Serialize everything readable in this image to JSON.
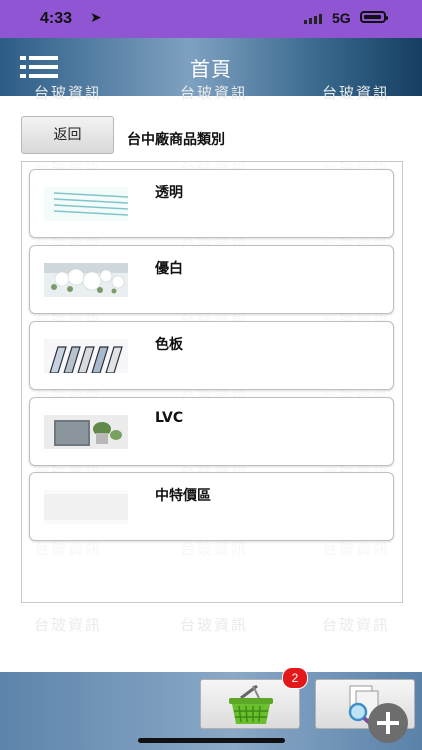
{
  "status_bar": {
    "time": "4:33",
    "network": "5G"
  },
  "header": {
    "title": "首頁"
  },
  "toolbar": {
    "back_label": "返回",
    "breadcrumb": "台中廠商品類別"
  },
  "categories": [
    {
      "label": "透明",
      "icon": "clear-glass-thumbnail"
    },
    {
      "label": "優白",
      "icon": "white-flower-thumbnail"
    },
    {
      "label": "色板",
      "icon": "colored-panels-thumbnail"
    },
    {
      "label": "LVC",
      "icon": "lvc-glass-thumbnail"
    },
    {
      "label": "中特價區",
      "icon": "special-price-thumbnail"
    }
  ],
  "watermark": {
    "text": "台玻資訊"
  },
  "bottom_bar": {
    "cart_count": "2"
  },
  "colors": {
    "status_bar": "#8f55d3",
    "nav_accent": "#2c5d86",
    "badge": "#e31919",
    "cart": "#6abf2e"
  }
}
